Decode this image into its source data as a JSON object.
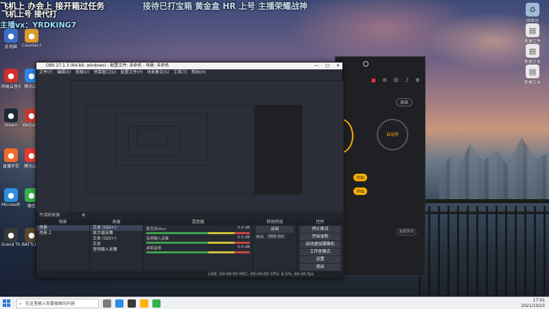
{
  "overlay": {
    "line1": "飞机上 办会上 接开箱过任务",
    "line2": "飞机上号 接代打",
    "line3": "主播vx：YRDKING7",
    "top_fade": "接待已打宝箱 黄金盒 HR 上号 主播荣耀战神"
  },
  "desktop_icons_left": [
    {
      "label": "此电脑",
      "icon": "pc-icon",
      "color": "#3a6fc9"
    },
    {
      "label": "Counter-Strike Global Off",
      "icon": "cs-icon",
      "color": "#d89a2a"
    },
    {
      "label": "网易云音乐",
      "icon": "music-icon",
      "color": "#d0302d"
    },
    {
      "label": "腾讯QQ",
      "icon": "qq-icon",
      "color": "#2b88e8"
    },
    {
      "label": "Steam",
      "icon": "steam-icon",
      "color": "#1b2838"
    },
    {
      "label": "WeGame",
      "icon": "wegame-icon",
      "color": "#c43a2f"
    },
    {
      "label": "直播伴侣",
      "icon": "live-icon",
      "color": "#f06a2a"
    },
    {
      "label": "腾讯QQ",
      "icon": "qq-icon",
      "color": "#ea3a30"
    },
    {
      "label": "Microsoft Edge",
      "icon": "edge-icon",
      "color": "#2d8ee0"
    },
    {
      "label": "微信",
      "icon": "wechat-icon",
      "color": "#36b24a"
    },
    {
      "label": "Grand Theft Auto V",
      "icon": "gta-icon",
      "color": "#3a3a3a"
    },
    {
      "label": "BATTLEGR...",
      "icon": "pubg-icon",
      "color": "#5a4a2a"
    }
  ],
  "desktop_icons_right": [
    {
      "label": "回收站",
      "icon": "recycle-icon"
    },
    {
      "label": "新建文件",
      "icon": "file-icon"
    },
    {
      "label": "新建文本",
      "icon": "file-icon"
    },
    {
      "label": "新建文本",
      "icon": "file-icon"
    }
  ],
  "obs": {
    "title": "OBS 27.1.3 (64-bit, windows) - 配置文件: 未命名 - 场景: 未命名",
    "menu": [
      "文件(F)",
      "编辑(E)",
      "视图(V)",
      "停靠窗口(D)",
      "配置文件(P)",
      "场景集合(S)",
      "工具(T)",
      "帮助(H)"
    ],
    "status_label": "不活跃来源",
    "docks": {
      "scenes": {
        "header": "场景",
        "items": [
          "场景",
          "场景 2"
        ]
      },
      "sources": {
        "header": "来源",
        "items": [
          "文本 (GDI+)",
          "显示器采集",
          "文本 (GDI+)",
          "文本",
          "音频输入采集"
        ]
      },
      "mixer": {
        "header": "混音器",
        "channels": [
          {
            "name": "麦克风/Aux",
            "db": "0.0 dB"
          },
          {
            "name": "音频输入采集",
            "db": "0.0 dB"
          },
          {
            "name": "桌面音频",
            "db": "0.0 dB"
          }
        ]
      },
      "transitions": {
        "header": "转场特效",
        "type": "淡出",
        "duration_label": "时长",
        "duration": "300 ms"
      },
      "controls": {
        "header": "控件",
        "buttons": [
          "停止推流",
          "开始录制",
          "启动虚拟摄像机",
          "工作室模式",
          "设置",
          "退出"
        ]
      }
    },
    "bottom_status": "LIVE: 00:00:00  REC: 00:00:00  CPU: 6.5%, 60.00 fps"
  },
  "app2": {
    "exit_label": "退出",
    "circle_label": "自动手",
    "btn1": "开始",
    "btn2": "开始",
    "bottom_label": "选择房间"
  },
  "taskbar": {
    "search_placeholder": "在这里输入你要搜索的内容",
    "time": "17:01",
    "date": "2021/10/23"
  }
}
